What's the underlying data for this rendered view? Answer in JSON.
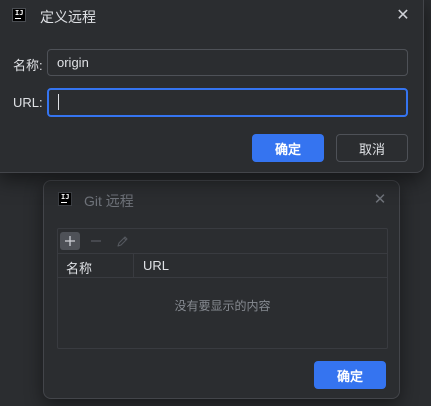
{
  "define_remote_dialog": {
    "app_icon_text": "IJ",
    "title": "定义远程",
    "close_glyph": "✕",
    "name_label": "名称:",
    "name_value": "origin",
    "url_label": "URL:",
    "url_value": "",
    "ok_label": "确定",
    "cancel_label": "取消"
  },
  "git_remotes_dialog": {
    "app_icon_text": "IJ",
    "title": "Git 远程",
    "close_glyph": "✕",
    "toolbar": {
      "add_icon": "plus-icon",
      "remove_icon": "minus-icon",
      "edit_icon": "pencil-icon"
    },
    "table": {
      "columns": [
        "名称",
        "URL"
      ],
      "rows": [],
      "empty_text": "没有要显示的内容"
    },
    "ok_label": "确定"
  },
  "colors": {
    "background": "#2b2d30",
    "accent": "#3574f0",
    "text": "#dfe1e5",
    "muted_text": "#6f737a",
    "border": "#4e5157"
  }
}
